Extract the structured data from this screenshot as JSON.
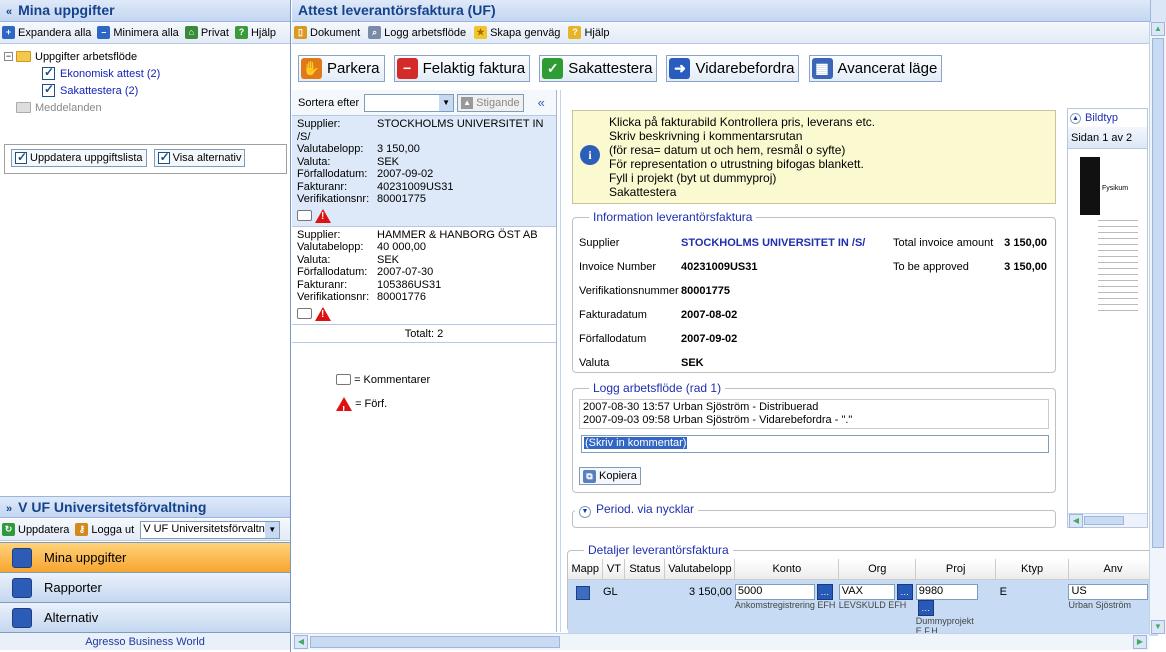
{
  "left": {
    "title": "Mina uppgifter",
    "toolbar": {
      "expand": "Expandera alla",
      "minimize": "Minimera alla",
      "private": "Privat",
      "help": "Hjälp"
    },
    "tree": {
      "root": "Uppgifter arbetsflöde",
      "items": [
        "Ekonomisk attest (2)",
        "Sakattestera (2)"
      ],
      "messages": "Meddelanden"
    },
    "buttons": {
      "refresh": "Uppdatera uppgiftslista",
      "show_alt": "Visa alternativ"
    },
    "org_title": "V UF Universitetsförvaltning",
    "org_toolbar": {
      "update": "Uppdatera",
      "logout": "Logga ut",
      "select_value": "V UF Universitetsförvaltn"
    },
    "nav": [
      "Mina uppgifter",
      "Rapporter",
      "Alternativ"
    ],
    "footer": "Agresso Business World"
  },
  "right": {
    "title": "Attest leverantörsfaktura (UF)",
    "toolbar": {
      "document": "Dokument",
      "log": "Logg arbetsflöde",
      "shortcut": "Skapa genväg",
      "help": "Hjälp"
    },
    "actions": [
      "Parkera",
      "Felaktig faktura",
      "Sakattestera",
      "Vidarebefordra",
      "Avancerat läge"
    ],
    "sort_label": "Sortera efter",
    "sort_dir": "Stigande",
    "invoices": [
      {
        "Supplier": "STOCKHOLMS UNIVERSITET IN /S/",
        "Valutabelopp": "3 150,00",
        "Valuta": "SEK",
        "Förfallodatum": "2007-09-02",
        "Fakturanr": "40231009US31",
        "Verifikationsnr": "80001775"
      },
      {
        "Supplier": "HAMMER & HANBORG ÖST AB",
        "Valutabelopp": "40 000,00",
        "Valuta": "SEK",
        "Förfallodatum": "2007-07-30",
        "Fakturanr": "105386US31",
        "Verifikationsnr": "80001776"
      }
    ],
    "keys": [
      "Supplier:",
      "Valutabelopp:",
      "Valuta:",
      "Förfallodatum:",
      "Fakturanr:",
      "Verifikationsnr:"
    ],
    "total": "Totalt: 2",
    "legend": {
      "comments": "= Kommentarer",
      "warn": "= Förf."
    },
    "info_lines": [
      "Klicka på fakturabild Kontrollera pris, leverans etc.",
      "Skriv beskrivning i kommentarsrutan",
      "(för resa= datum ut och hem, resmål o syfte)",
      "För representation o utrustning bifogas blankett.",
      "Fyll i projekt (byt ut dummyproj)",
      "Sakattestera"
    ],
    "info_section": {
      "legend": "Information leverantörsfaktura",
      "labels": [
        "Supplier",
        "Invoice Number",
        "Verifikationsnummer",
        "Fakturadatum",
        "Förfallodatum",
        "Valuta"
      ],
      "values": [
        "STOCKHOLMS UNIVERSITET IN /S/",
        "40231009US31",
        "80001775",
        "2007-08-02",
        "2007-09-02",
        "SEK"
      ],
      "total_label": "Total invoice amount",
      "total_value": "3 150,00",
      "approve_label": "To be approved",
      "approve_value": "3 150,00"
    },
    "log_section": {
      "legend": "Logg arbetsflöde (rad 1)",
      "entries": [
        "2007-08-30 13:57 Urban Sjöström - Distribuerad",
        "2007-09-03 09:58 Urban Sjöström - Vidarebefordra - \".\""
      ],
      "comment_placeholder": "(Skriv in kommentar)",
      "copy": "Kopiera"
    },
    "period_legend": "Period. via nycklar",
    "details": {
      "legend": "Detaljer leverantörsfaktura",
      "headers": [
        "Mapp",
        "VT",
        "Status",
        "Valutabelopp",
        "Konto",
        "Org",
        "Proj",
        "Ktyp",
        "Anv"
      ],
      "row": {
        "vt": "GL",
        "amount": "3 150,00",
        "konto": "5000",
        "konto_desc": "Ankomstregistrering EFH",
        "org": "VAX",
        "org_desc": "LEVSKULD EFH",
        "proj": "9980",
        "proj_desc": "Dummyprojekt E.F.H",
        "ktyp": "E",
        "anv": "US",
        "anv_desc": "Urban Sjöström"
      }
    },
    "image": {
      "legend": "Bildtyp",
      "page": "Sidan 1 av 2",
      "heading": "Fysikum"
    }
  },
  "colors": {
    "header_text": "#15428b",
    "nav_active": "#f7a52f",
    "info_bg": "#fbf9d0",
    "legend_text": "#1e2fb0"
  }
}
